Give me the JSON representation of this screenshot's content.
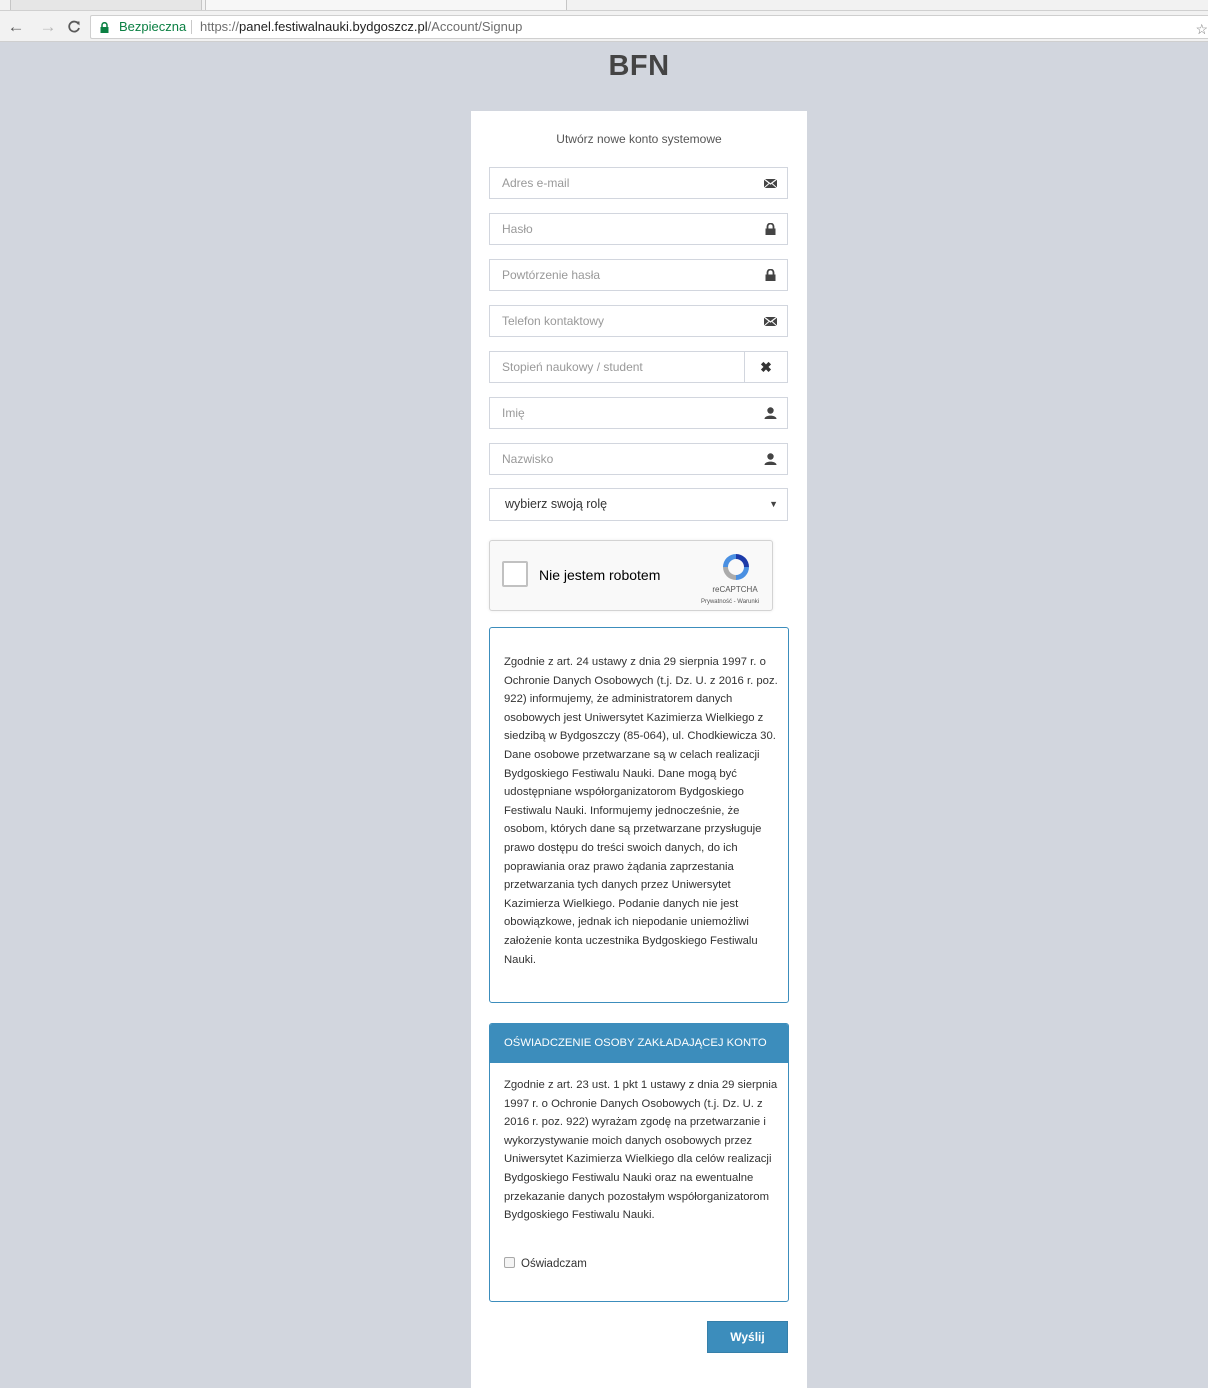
{
  "browser": {
    "back_icon": "arrow-left-icon",
    "forward_icon": "arrow-right-icon",
    "reload_icon": "reload-icon",
    "secure_label": "Bezpieczna",
    "url_scheme": "https://",
    "url_host": "panel.festiwalnauki.bydgoszcz.pl",
    "url_path": "/Account/Signup",
    "colors": {
      "secure": "#0b8043"
    }
  },
  "page": {
    "brand": "BFN",
    "form_title": "Utwórz nowe konto systemowe",
    "fields": {
      "email": {
        "placeholder": "Adres e-mail",
        "icon": "envelope-icon"
      },
      "password": {
        "placeholder": "Hasło",
        "icon": "lock-icon"
      },
      "password_repeat": {
        "placeholder": "Powtórzenie hasła",
        "icon": "lock-icon"
      },
      "phone": {
        "placeholder": "Telefon kontaktowy",
        "icon": "envelope-icon"
      },
      "degree": {
        "placeholder": "Stopień naukowy / student",
        "icon": "close-icon",
        "addon_symbol": "✖"
      },
      "first_name": {
        "placeholder": "Imię",
        "icon": "user-icon"
      },
      "last_name": {
        "placeholder": "Nazwisko",
        "icon": "user-icon"
      }
    },
    "role_select": {
      "selected": "wybierz swoją rolę",
      "caret": "▼"
    },
    "captcha": {
      "label": "Nie jestem robotem",
      "brand": "reCAPTCHA",
      "terms": "Prywatność - Warunki"
    },
    "info_text": "Zgodnie z art. 24 ustawy z dnia 29 sierpnia 1997 r. o Ochronie Danych Osobowych (t.j. Dz. U. z 2016 r. poz. 922) informujemy, że administratorem danych osobowych jest Uniwersytet Kazimierza Wielkiego z siedzibą w Bydgoszczy (85-064), ul. Chodkiewicza 30. Dane osobowe przetwarzane są w celach realizacji Bydgoskiego Festiwalu Nauki. Dane mogą być udostępniane współorganizatorom Bydgoskiego Festiwalu Nauki. Informujemy jednocześnie, że osobom, których dane są przetwarzane przysługuje prawo dostępu do treści swoich danych, do ich poprawiania oraz prawo żądania zaprzestania przetwarzania tych danych przez Uniwersytet Kazimierza Wielkiego. Podanie danych nie jest obowiązkowe, jednak ich niepodanie uniemożliwi założenie konta uczestnika Bydgoskiego Festiwalu Nauki.",
    "consent": {
      "header": "OŚWIADCZENIE OSOBY ZAKŁADAJĄCEJ KONTO",
      "text": "Zgodnie z art. 23 ust. 1 pkt 1 ustawy z dnia 29 sierpnia 1997 r. o Ochronie Danych Osobowych (t.j. Dz. U. z 2016 r. poz. 922) wyrażam zgodę na przetwarzanie i wykorzystywanie moich danych osobowych przez Uniwersytet Kazimierza Wielkiego dla celów realizacji Bydgoskiego Festiwalu Nauki oraz na ewentualne przekazanie danych pozostałym współorganizatorom Bydgoskiego Festiwalu Nauki.",
      "checkbox_label": "Oświadczam",
      "checked": false
    },
    "submit_label": "Wyślij",
    "colors": {
      "accent": "#3c8dbc",
      "background": "#d2d6de"
    }
  }
}
